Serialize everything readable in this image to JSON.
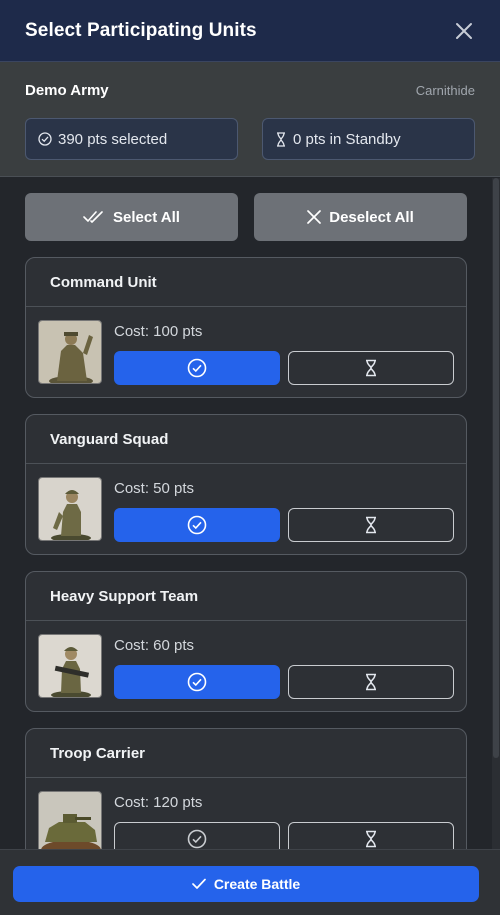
{
  "header": {
    "title": "Select Participating Units"
  },
  "army": {
    "name": "Demo Army",
    "faction": "Carnithide"
  },
  "summary": {
    "selected": "390 pts selected",
    "standby": "0 pts in Standby"
  },
  "bulk": {
    "select_all": "Select All",
    "deselect_all": "Deselect All"
  },
  "units": [
    {
      "name": "Command Unit",
      "cost": "Cost: 100 pts",
      "selected": true
    },
    {
      "name": "Vanguard Squad",
      "cost": "Cost: 50 pts",
      "selected": true
    },
    {
      "name": "Heavy Support Team",
      "cost": "Cost: 60 pts",
      "selected": true
    },
    {
      "name": "Troop Carrier",
      "cost": "Cost: 120 pts",
      "selected": false
    }
  ],
  "footer": {
    "create_label": "Create Battle"
  },
  "colors": {
    "accent": "#2563eb",
    "header_bg": "#1e2a4a",
    "bg": "#23262b"
  },
  "icons": {
    "close": "close-icon",
    "selected": "check-circle-icon",
    "standby": "hourglass-icon",
    "select_all": "double-check-icon",
    "deselect_all": "x-icon",
    "create": "check-icon"
  }
}
